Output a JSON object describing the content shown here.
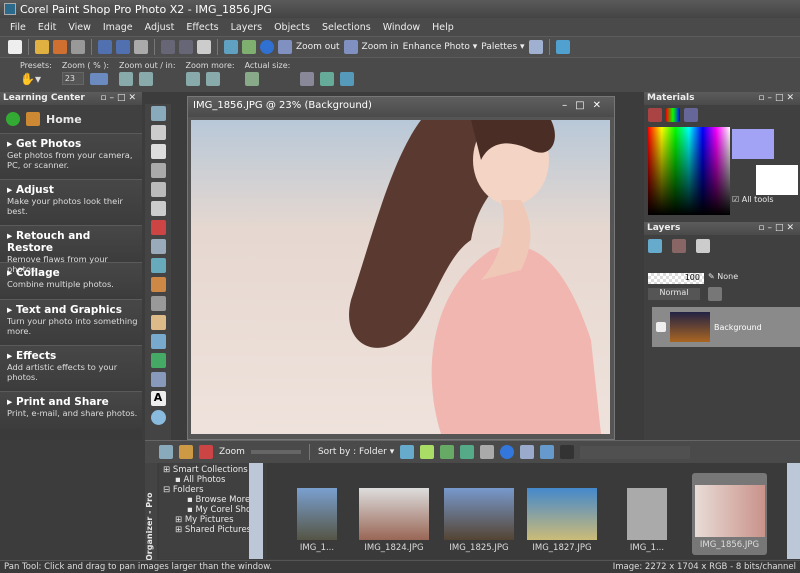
{
  "window_title": "Corel Paint Shop Pro Photo X2 - IMG_1856.JPG",
  "menu": [
    "File",
    "Edit",
    "View",
    "Image",
    "Adjust",
    "Effects",
    "Layers",
    "Objects",
    "Selections",
    "Window",
    "Help"
  ],
  "toolbar": {
    "zoom_out": "Zoom out",
    "zoom_in": "Zoom in",
    "enhance_photo": "Enhance Photo",
    "palettes": "Palettes"
  },
  "tool_options": {
    "presets": "Presets:",
    "zoom_pct": "Zoom ( % ):",
    "zoom_value": "23",
    "zoom_out_in": "Zoom out / in:",
    "zoom_more": "Zoom more:",
    "actual_size": "Actual size:"
  },
  "learning_center": {
    "title": "Learning Center",
    "home": "Home",
    "items": [
      {
        "title": "Get Photos",
        "desc": "Get photos from your camera, PC, or scanner."
      },
      {
        "title": "Adjust",
        "desc": "Make your photos look their best."
      },
      {
        "title": "Retouch and Restore",
        "desc": "Remove flaws from your photos."
      },
      {
        "title": "Collage",
        "desc": "Combine multiple photos."
      },
      {
        "title": "Text and Graphics",
        "desc": "Turn your photo into something more."
      },
      {
        "title": "Effects",
        "desc": "Add artistic effects to your photos."
      },
      {
        "title": "Print and Share",
        "desc": "Print, e-mail, and share photos."
      }
    ]
  },
  "image_window": {
    "title": "IMG_1856.JPG @  23% (Background)"
  },
  "materials": {
    "title": "Materials",
    "foreground_color": "#a3a3f5",
    "background_color": "#ffffff",
    "all_tools": "All tools",
    "all_tools_checked": true
  },
  "layers": {
    "title": "Layers",
    "opacity": "100",
    "mask": "None",
    "blend_mode": "Normal",
    "layer_name": "Background"
  },
  "organizer": {
    "label": "Organizer - Pro",
    "zoom": "Zoom",
    "sort_by": "Sort by : Folder",
    "tree": [
      {
        "label": "Smart Collections",
        "level": 0
      },
      {
        "label": "All Photos",
        "level": 0
      },
      {
        "label": "Folders",
        "level": 0
      },
      {
        "label": "Browse More",
        "level": 1
      },
      {
        "label": "My Corel Shots",
        "level": 1
      },
      {
        "label": "My Pictures",
        "level": 1
      },
      {
        "label": "Shared Pictures",
        "level": 1
      }
    ],
    "thumbnails": [
      {
        "name": "IMG_1..."
      },
      {
        "name": "IMG_1824.JPG"
      },
      {
        "name": "IMG_1825.JPG"
      },
      {
        "name": "IMG_1827.JPG"
      },
      {
        "name": "IMG_1..."
      },
      {
        "name": "IMG_1856.JPG",
        "selected": true
      }
    ]
  },
  "status": {
    "left": "Pan Tool: Click and drag to pan images larger than the window.",
    "right": "Image:  2272 x 1704 x RGB - 8 bits/channel"
  }
}
